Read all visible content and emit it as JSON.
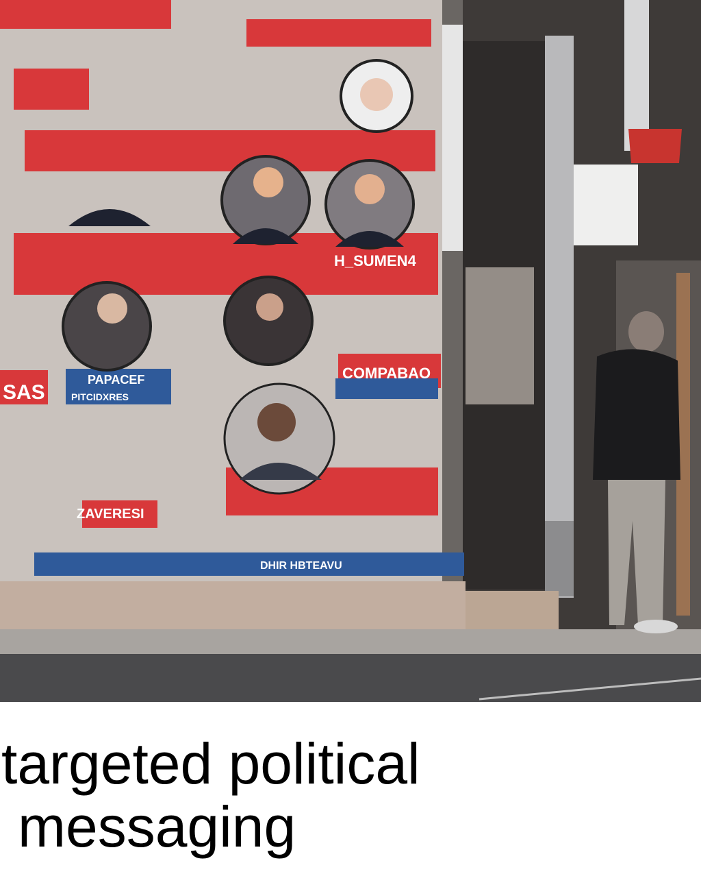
{
  "caption": {
    "line1": "targeted political",
    "line2": "messaging"
  },
  "photo_signs": {
    "sign_a": "H_SUMEN4",
    "sign_b": "COMPABAO",
    "sign_c": "PAPACEF",
    "sign_d": "PITCIDXRES",
    "sign_e": "ZAVERESI",
    "sign_f": "DHIR HBTEAVU",
    "sign_g": "SAS"
  },
  "colors": {
    "poster_red": "#d8383a",
    "poster_blue": "#2f5a9a",
    "pavement": "#a8a4a0",
    "road": "#4a4a4c"
  }
}
